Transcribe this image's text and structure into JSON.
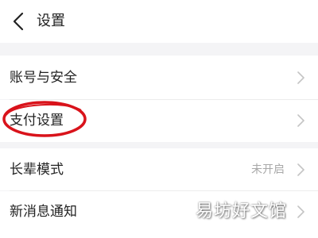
{
  "header": {
    "back_icon": "chevron-left-icon",
    "title": "设置"
  },
  "settings": {
    "account_security": {
      "label": "账号与安全",
      "icon": "chevron-right-icon"
    },
    "payment": {
      "label": "支付设置",
      "icon": "chevron-right-icon",
      "annotation_color": "#d9131b"
    },
    "elder_mode": {
      "label": "长辈模式",
      "value": "未开启",
      "icon": "chevron-right-icon"
    },
    "notifications": {
      "label": "新消息通知",
      "icon": "chevron-right-icon"
    }
  },
  "watermark": {
    "text": "易坊好文馆"
  },
  "colors": {
    "background": "#f4f4f6",
    "surface": "#ffffff",
    "text": "#222222",
    "muted": "#a8a8a8"
  }
}
